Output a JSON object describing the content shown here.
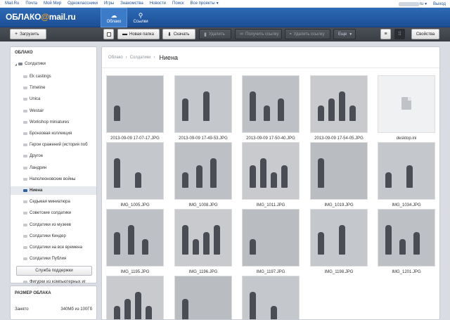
{
  "topnav": {
    "links": [
      "Mail.Ru",
      "Почта",
      "Мой Мир",
      "Одноклассники",
      "Игры",
      "Знакомства",
      "Новости",
      "Поиск",
      "Все проекты"
    ],
    "account": "xxxxxxxxx",
    "account_domain": "ru",
    "exit": "Выход"
  },
  "brand": {
    "logo_pre": "ОБЛАКО",
    "logo_at": "@",
    "logo_post": "mail.ru"
  },
  "tabs": [
    {
      "label": "Облако",
      "icon": "cloud-icon"
    },
    {
      "label": "Ссылки",
      "icon": "link-icon"
    }
  ],
  "toolbar": {
    "upload": "Загрузить",
    "new_folder": "Новая папка",
    "download": "Скачать",
    "delete": "Удалить",
    "get_link": "Получить ссылку",
    "remove_link": "Удалить ссылку",
    "more": "Еще",
    "properties": "Свойства"
  },
  "sidebar": {
    "title": "ОБЛАКО",
    "root": "Солдатики",
    "folders": [
      "Ek castings",
      "Timeline",
      "Unica",
      "Westair",
      "Workshop miniatures",
      "Бронзовая коллекция",
      "Герои сражений (история поб",
      "Другое",
      "Ландрин",
      "Наполеоновские войны",
      "Ниена",
      "Седьмая миниатюра",
      "Советские солдатики",
      "Солдатики из музеев",
      "Солдатики Киндер",
      "Солдатики на все времена",
      "Солдатики Публия",
      "Солдаты Великой Отечествен",
      "Фигурки из компьютерных иг"
    ],
    "selected": "Ниена",
    "support": "Служба поддержки"
  },
  "cloudsize": {
    "title": "РАЗМЕР ОБЛАКА",
    "used_label": "Занято",
    "used_value": "340Мб из 100Гб"
  },
  "breadcrumb": {
    "root": "Облако",
    "parent": "Солдатики",
    "current": "Ниена"
  },
  "files": [
    "2013-09-09 17-07-17.JPG",
    "2013-09-09 17-49-53.JPG",
    "2013-09-09 17-50-40.JPG",
    "2013-09-09 17-54-05.JPG",
    "desktop.ini",
    "IMG_1005.JPG",
    "IMG_1008.JPG",
    "IMG_1011.JPG",
    "IMG_1019.JPG",
    "IMG_1034.JPG",
    "IMG_1195.JPG",
    "IMG_1196.JPG",
    "IMG_1197.JPG",
    "IMG_1198.JPG",
    "IMG_1201.JPG",
    "",
    "",
    ""
  ]
}
